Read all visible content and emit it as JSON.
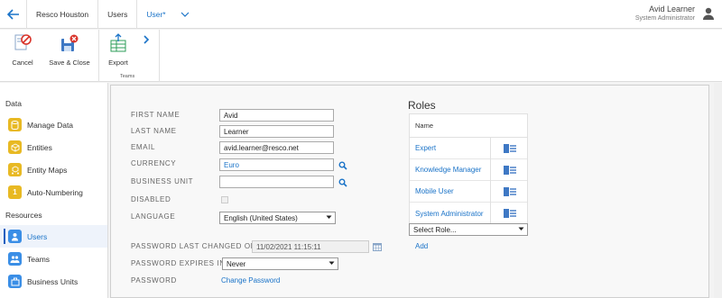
{
  "breadcrumb": {
    "items": [
      "Resco Houston",
      "Users",
      "User*"
    ]
  },
  "user": {
    "name": "Avid Learner",
    "role": "System Administrator"
  },
  "toolbar": {
    "cancel": "Cancel",
    "save_close": "Save & Close",
    "export": "Export",
    "group": "Teams"
  },
  "sidebar": {
    "section_data": "Data",
    "section_resources": "Resources",
    "items": [
      {
        "label": "Manage Data",
        "icon": "database-icon",
        "color": "#e8b923"
      },
      {
        "label": "Entities",
        "icon": "cube-icon",
        "color": "#e8b923"
      },
      {
        "label": "Entity Maps",
        "icon": "entity-maps-icon",
        "color": "#e8b923"
      },
      {
        "label": "Auto-Numbering",
        "icon": "numbering-icon",
        "color": "#e8b923"
      },
      {
        "label": "Users",
        "icon": "user-icon",
        "color": "#3a8ee6"
      },
      {
        "label": "Teams",
        "icon": "teams-icon",
        "color": "#3a8ee6"
      },
      {
        "label": "Business Units",
        "icon": "business-units-icon",
        "color": "#3a8ee6"
      }
    ],
    "numbering_glyph": "1"
  },
  "form": {
    "first_name_label": "FIRST NAME",
    "first_name": "Avid",
    "last_name_label": "LAST NAME",
    "last_name": "Learner",
    "email_label": "EMAIL",
    "email": "avid.learner@resco.net",
    "currency_label": "CURRENCY",
    "currency": "Euro",
    "business_unit_label": "BUSINESS UNIT",
    "business_unit": "",
    "disabled_label": "DISABLED",
    "language_label": "LANGUAGE",
    "language": "English (United States)",
    "pw_changed_label": "PASSWORD LAST CHANGED ON",
    "pw_changed": "11/02/2021 11:15:11",
    "pw_expires_label": "PASSWORD EXPIRES IN",
    "pw_expires": "Never",
    "password_label": "PASSWORD",
    "change_password": "Change Password"
  },
  "roles": {
    "title": "Roles",
    "column": "Name",
    "items": [
      "Expert",
      "Knowledge Manager",
      "Mobile User",
      "System Administrator"
    ],
    "select_placeholder": "Select Role...",
    "add": "Add"
  },
  "colors": {
    "accent": "#1a73c8",
    "danger": "#d9342b"
  }
}
